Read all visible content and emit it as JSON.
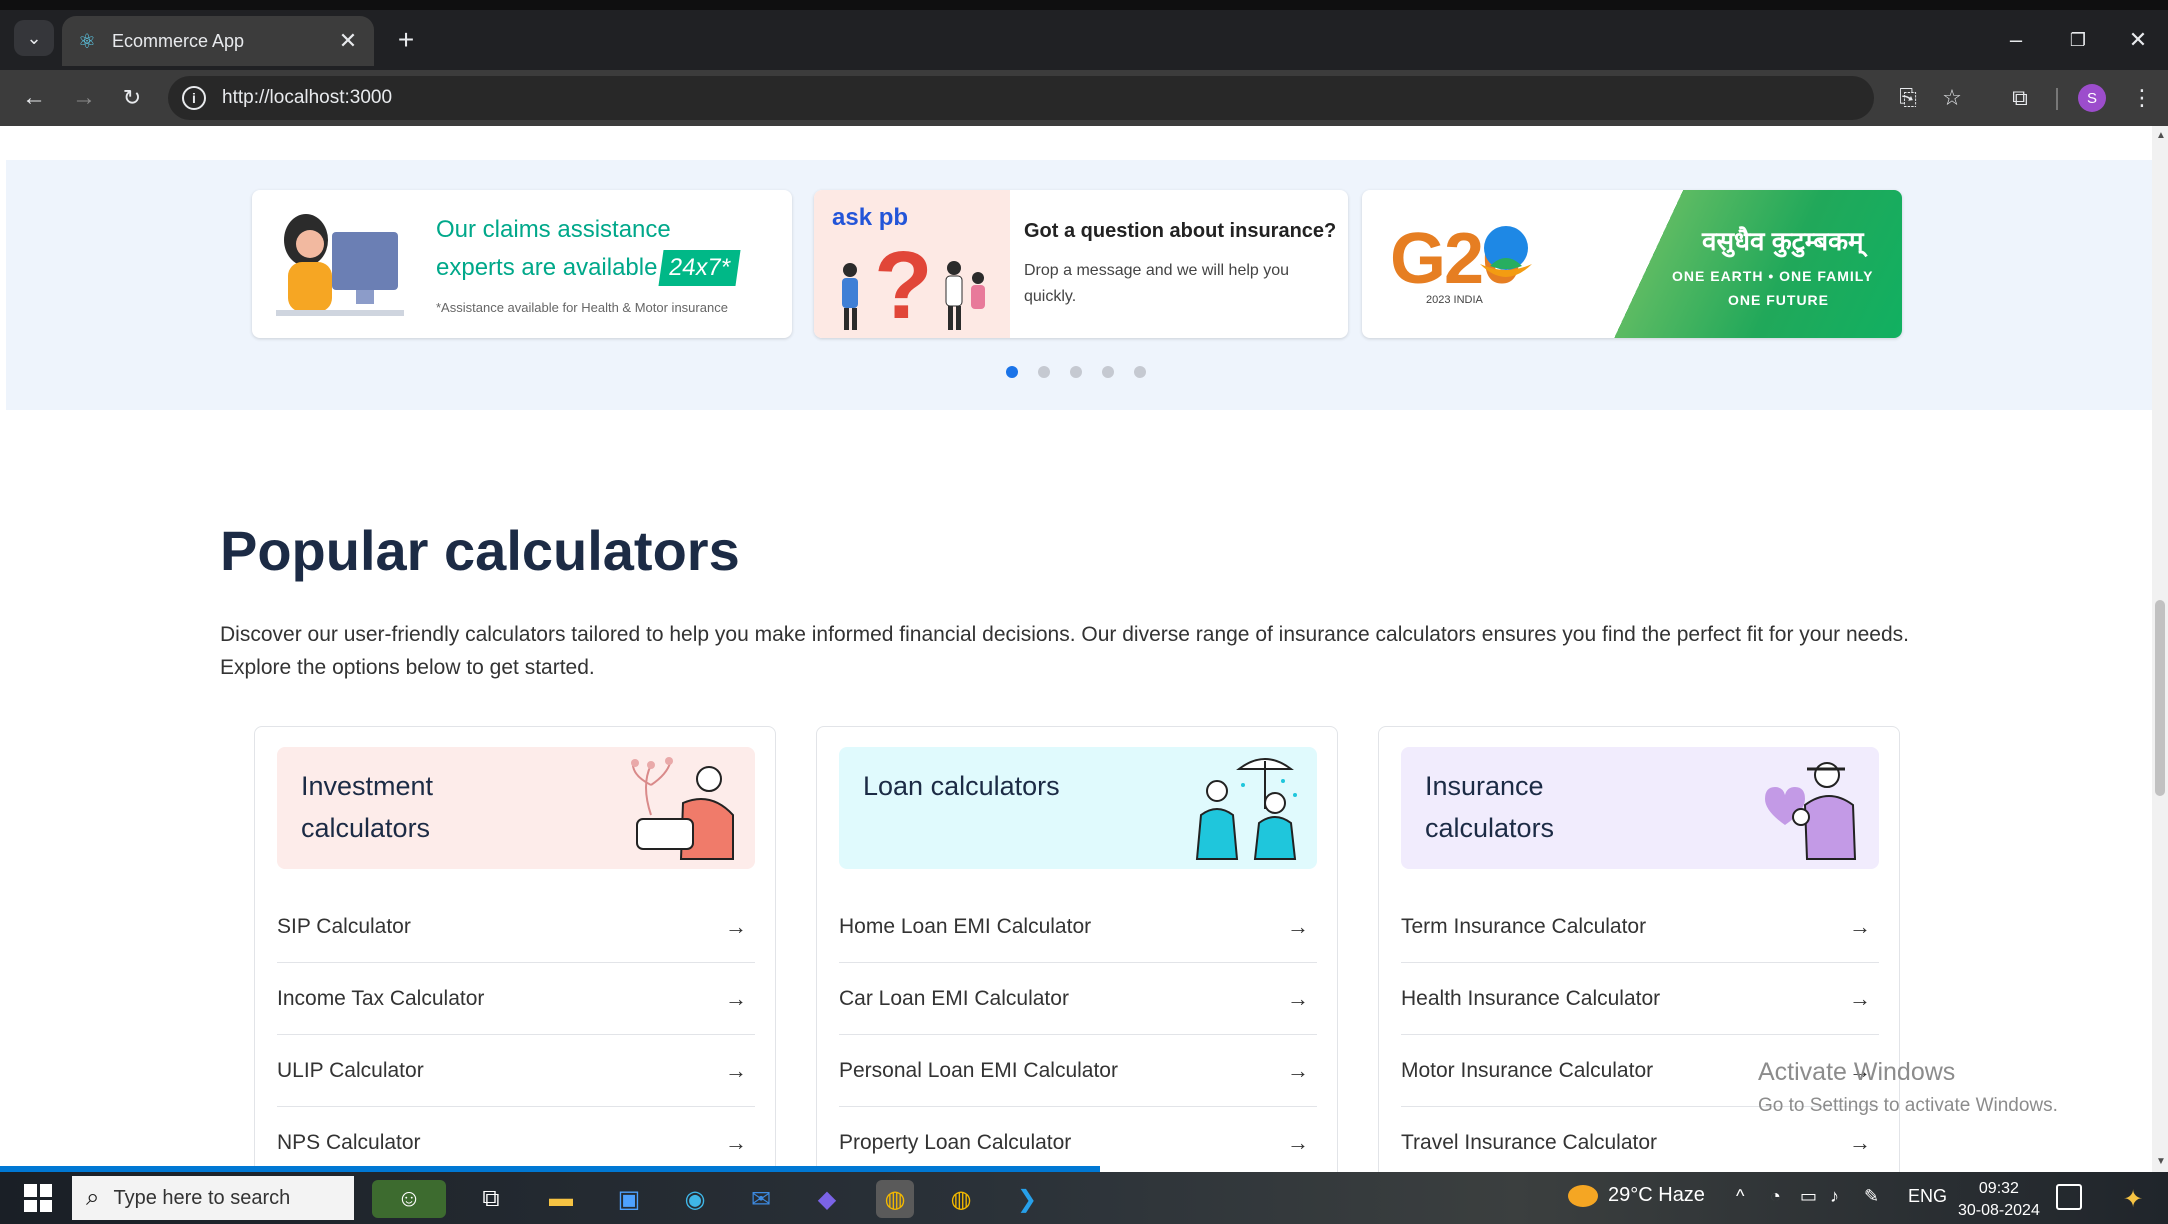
{
  "browser": {
    "tab_title": "Ecommerce App",
    "tab_close": "✕",
    "new_tab": "+",
    "url": "http://localhost:3000",
    "profile_initial": "S"
  },
  "banners": {
    "claims": {
      "line1": "Our claims assistance",
      "line2": "experts are available",
      "badge": "24x7*",
      "note": "*Assistance available for Health & Motor insurance"
    },
    "askpb": {
      "brand": "ask pb",
      "title": "Got a question about insurance?",
      "desc": "Drop a message and we will help you quickly."
    },
    "g20": {
      "logo": "G20",
      "sub": "2023 INDIA",
      "hindi": "वसुधैव कुटुम्बकम्",
      "line1": "ONE EARTH • ONE FAMILY",
      "line2": "ONE FUTURE"
    },
    "carousel_dots": 5,
    "active_dot": 0
  },
  "section": {
    "title": "Popular calculators",
    "intro": "Discover our user-friendly calculators tailored to help you make informed financial decisions. Our diverse range of insurance calculators ensures you find the perfect fit for your needs. Explore the options below to get started."
  },
  "cards": [
    {
      "title": "Investment calculators",
      "bg": "#fdecea",
      "items": [
        "SIP Calculator",
        "Income Tax Calculator",
        "ULIP Calculator",
        "NPS Calculator"
      ]
    },
    {
      "title": "Loan calculators",
      "bg": "#e0fafd",
      "items": [
        "Home Loan EMI Calculator",
        "Car Loan EMI Calculator",
        "Personal Loan EMI Calculator",
        "Property Loan Calculator"
      ]
    },
    {
      "title": "Insurance calculators",
      "bg": "#f1ecfd",
      "items": [
        "Term Insurance Calculator",
        "Health Insurance Calculator",
        "Motor Insurance Calculator",
        "Travel Insurance Calculator"
      ]
    }
  ],
  "arrow_glyph": "→",
  "watermark": {
    "line1": "Activate Windows",
    "line2": "Go to Settings to activate Windows."
  },
  "taskbar": {
    "search_placeholder": "Type here to search",
    "weather": "29°C  Haze",
    "lang": "ENG",
    "time": "09:32",
    "date": "30-08-2024"
  }
}
